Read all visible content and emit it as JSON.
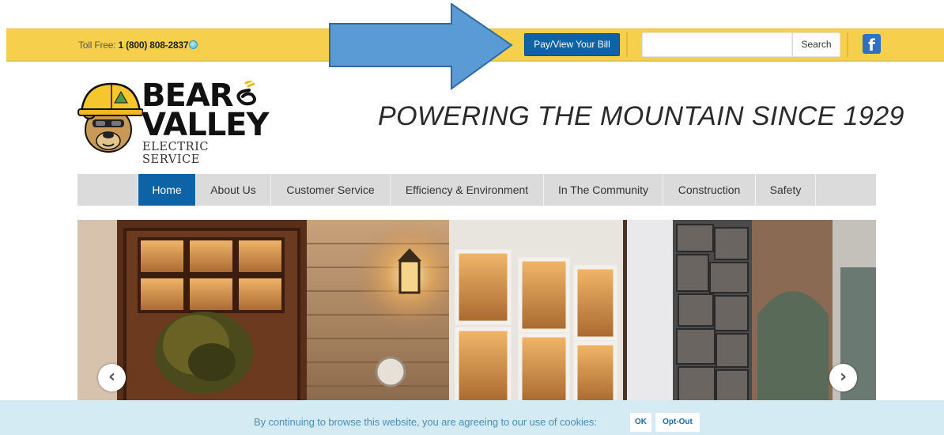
{
  "topbar": {
    "toll_free_label": "Toll Free:",
    "toll_free_number": "1 (800) 808-2837",
    "pay_bill_label": "Pay/View Your Bill",
    "search_placeholder": "",
    "search_button_label": "Search",
    "facebook_icon": "facebook-icon",
    "background_color": "#f6d04d",
    "button_color": "#0d63a5"
  },
  "header": {
    "logo_line1": "BEAR",
    "logo_line2": "VALLEY",
    "logo_subtitle": "ELECTRIC SERVICE",
    "tagline": "POWERING THE MOUNTAIN SINCE 1929"
  },
  "nav": {
    "items": [
      {
        "label": "Home",
        "active": true
      },
      {
        "label": "About Us",
        "active": false
      },
      {
        "label": "Customer Service",
        "active": false
      },
      {
        "label": "Efficiency & Environment",
        "active": false
      },
      {
        "label": "In The Community",
        "active": false
      },
      {
        "label": "Construction",
        "active": false
      },
      {
        "label": "Safety",
        "active": false
      }
    ]
  },
  "hero": {
    "prev_icon": "chevron-left-icon",
    "next_icon": "chevron-right-icon"
  },
  "cookie": {
    "message": "By continuing to browse this website, you are agreeing to our use of cookies:",
    "ok_label": "OK",
    "optout_label": "Opt-Out"
  }
}
